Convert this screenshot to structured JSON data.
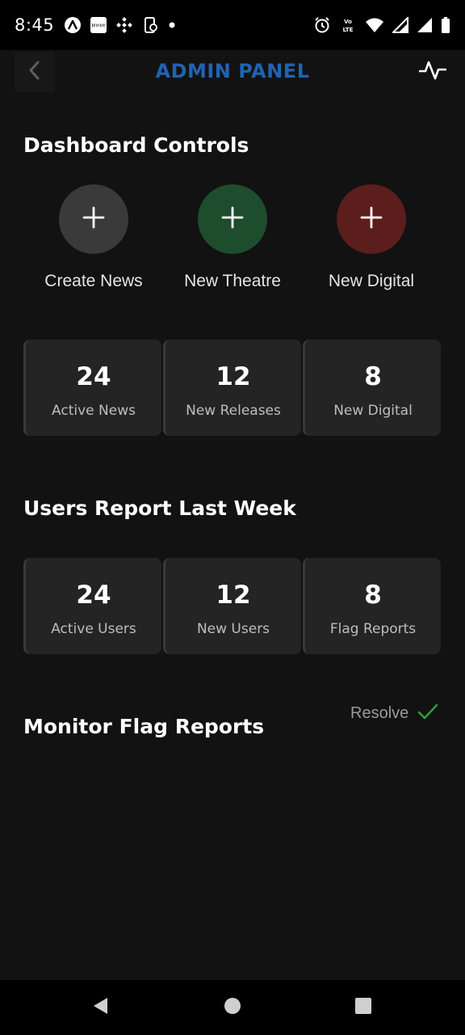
{
  "status_bar": {
    "time": "8:45",
    "left_icons": [
      "a-logo-icon",
      "blinkit-icon",
      "binance-icon",
      "phone-sync-icon",
      "dot-icon"
    ],
    "blinkit_text": "blinkit",
    "volte_text": "Vo LTE",
    "right_icons": [
      "alarm-icon",
      "volte-icon",
      "wifi-icon",
      "signal-icon",
      "signal-icon",
      "battery-icon"
    ]
  },
  "header": {
    "title": "ADMIN PANEL",
    "back_icon": "chevron-left-icon",
    "activity_icon": "pulse-icon",
    "title_color": "#1f63b4"
  },
  "dashboard_controls": {
    "title": "Dashboard Controls",
    "actions": [
      {
        "label": "Create News",
        "color": "#3a3a3a",
        "icon": "plus-icon"
      },
      {
        "label": "New Theatre",
        "color": "#1e4d2e",
        "icon": "plus-icon"
      },
      {
        "label": "New Digital",
        "color": "#5c1d1d",
        "icon": "plus-icon"
      }
    ],
    "stats": [
      {
        "value": "24",
        "label": "Active News"
      },
      {
        "value": "12",
        "label": "New Releases"
      },
      {
        "value": "8",
        "label": "New Digital"
      }
    ]
  },
  "users_report": {
    "title": "Users Report Last Week",
    "stats": [
      {
        "value": "24",
        "label": "Active Users"
      },
      {
        "value": "12",
        "label": "New Users"
      },
      {
        "value": "8",
        "label": "Flag Reports"
      }
    ]
  },
  "flag_reports": {
    "title": "Monitor Flag Reports",
    "resolve_label": "Resolve",
    "resolve_icon": "check-icon",
    "resolve_color": "#2e9e3a"
  },
  "nav_bar": {
    "icons": [
      "back-triangle-icon",
      "home-circle-icon",
      "recents-square-icon"
    ]
  }
}
